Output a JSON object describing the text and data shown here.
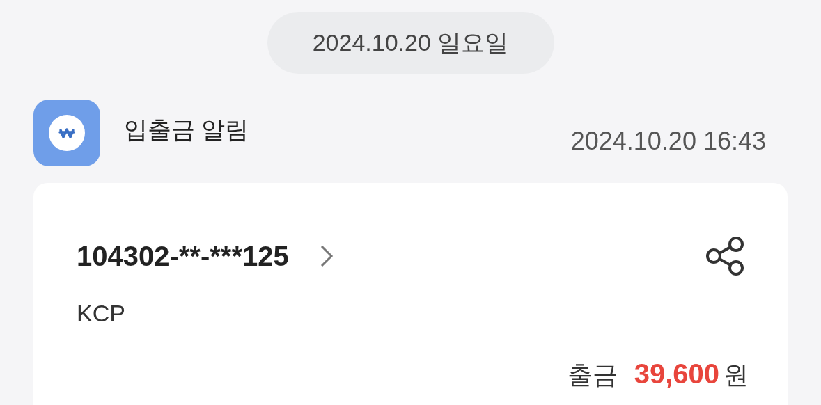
{
  "date_divider": "2024.10.20 일요일",
  "message": {
    "sender": "입출금 알림",
    "time": "2024.10.20 16:43",
    "card": {
      "account": "104302-**-***125",
      "counterparty": "KCP",
      "type_label": "출금",
      "amount": "39,600",
      "currency": "원"
    }
  }
}
